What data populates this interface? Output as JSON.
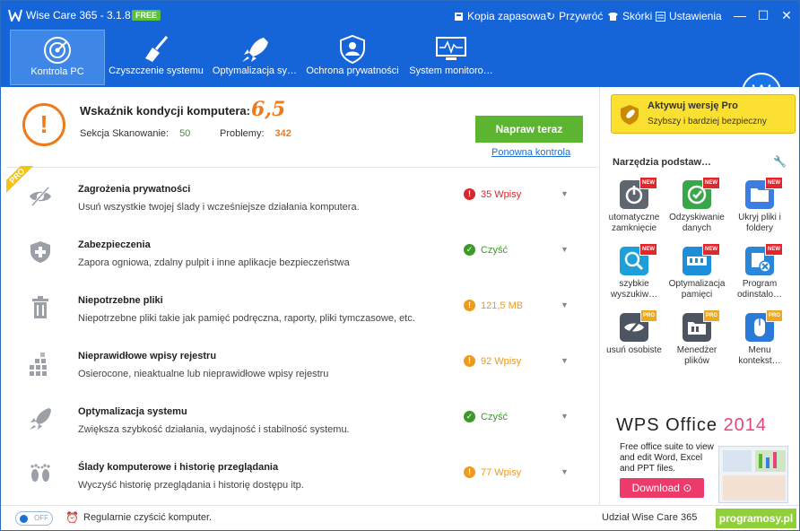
{
  "app": {
    "title": "Wise Care 365 - 3.1.8",
    "badge": "FREE"
  },
  "titlebar": {
    "links": [
      {
        "icon": "backup-icon",
        "label": "Kopia zapasowa"
      },
      {
        "icon": "restore-icon",
        "label": "Przywróć"
      },
      {
        "icon": "shirt-icon",
        "label": "Skórki"
      },
      {
        "icon": "settings-icon",
        "label": "Ustawienia"
      }
    ]
  },
  "nav": {
    "items": [
      {
        "label": "Kontrola PC",
        "icon": "radar-icon",
        "active": true
      },
      {
        "label": "Czyszczenie systemu",
        "icon": "broom-icon"
      },
      {
        "label": "Optymalizacja sy…",
        "icon": "rocket-icon"
      },
      {
        "label": "Ochrona prywatności",
        "icon": "user-shield-icon"
      },
      {
        "label": "System monitoro…",
        "icon": "monitor-icon"
      }
    ],
    "avatar": "W"
  },
  "health": {
    "title": "Wskaźnik kondycji komputera:",
    "score": "6,5",
    "scan_label": "Sekcja Skanowanie:",
    "scan_value": "50",
    "problems_label": "Problemy:",
    "problems_value": "342",
    "fix_button": "Napraw teraz",
    "recheck_link": "Ponowna kontrola",
    "pro_tag": "PRO"
  },
  "rows": [
    {
      "title": "Zagrożenia prywatności",
      "desc": "Usuń wszystkie twojej ślady i wcześniejsze działania komputera.",
      "status": "35 Wpisy",
      "status_type": "error",
      "status_color": "#d9262c",
      "icon": "eye-slash-icon"
    },
    {
      "title": "Zabezpieczenia",
      "desc": "Zapora ogniowa, zdalny pulpit i inne aplikacje bezpieczeństwa",
      "status": "Czyść",
      "status_type": "ok",
      "status_color": "#3c9a28",
      "icon": "shield-plus-icon"
    },
    {
      "title": "Niepotrzebne pliki",
      "desc": "Niepotrzebne pliki takie jak pamięć podręczna, raporty, pliki tymczasowe, etc.",
      "status": "121,5 MB",
      "status_type": "warn",
      "status_color": "#ef9a1a",
      "icon": "trash-icon"
    },
    {
      "title": "Nieprawidłowe wpisy rejestru",
      "desc": "Osierocone, nieaktualne lub nieprawidłowe wpisy rejestru",
      "status": "92 Wpisy",
      "status_type": "warn",
      "status_color": "#ef9a1a",
      "icon": "registry-blocks-icon"
    },
    {
      "title": "Optymalizacja systemu",
      "desc": "Zwiększa szybkość działania, wydajność i stabilność systemu.",
      "status": "Czyść",
      "status_type": "ok",
      "status_color": "#3c9a28",
      "icon": "rocket-icon"
    },
    {
      "title": "Ślady komputerowe i historię przeglądania",
      "desc": "Wyczyść historię przeglądania i historię dostępu itp.",
      "status": "77 Wpisy",
      "status_type": "warn",
      "status_color": "#ef9a1a",
      "icon": "footprints-icon"
    }
  ],
  "sidebar": {
    "pro_title": "Aktywuj wersję Pro",
    "pro_sub": "Szybszy i bardziej bezpieczny",
    "tools_title": "Narzędzia podstaw…",
    "tools": [
      {
        "label": "utomatyczne zamknięcie",
        "badge": "NEW",
        "color": "#5f6670",
        "icon": "power-icon"
      },
      {
        "label": "Odzyskiwanie danych",
        "badge": "NEW",
        "color": "#3aa64a",
        "icon": "recover-icon"
      },
      {
        "label": "Ukryj pliki i foldery",
        "badge": "NEW",
        "color": "#3b7de0",
        "icon": "folder-icon"
      },
      {
        "label": "szybkie wyszukiw…",
        "badge": "NEW",
        "color": "#1da0d8",
        "icon": "search-icon"
      },
      {
        "label": "Optymalizacja pamięci",
        "badge": "NEW",
        "color": "#1d8ed8",
        "icon": "memory-icon"
      },
      {
        "label": "Program odinstalo…",
        "badge": "NEW",
        "color": "#2a86d8",
        "icon": "uninstall-icon"
      },
      {
        "label": "usuń osobiste",
        "badge": "PRO",
        "color": "#4d5560",
        "icon": "eye-slash-icon"
      },
      {
        "label": "Menedżer plików",
        "badge": "PRO",
        "color": "#4d5560",
        "icon": "files-icon"
      },
      {
        "label": "Menu kontekst…",
        "badge": "PRO",
        "color": "#2a7bd8",
        "icon": "mouse-icon"
      }
    ],
    "ad": {
      "brand": "WPS Office",
      "year": "2014",
      "text": "Free office suite to view and edit Word, Excel and PPT files.",
      "button": "Download"
    }
  },
  "status": {
    "toggle": "OFF",
    "text": "Regularnie czyścić komputer.",
    "share": "Udział Wise Care 365",
    "watermark": "programosy.pl"
  }
}
